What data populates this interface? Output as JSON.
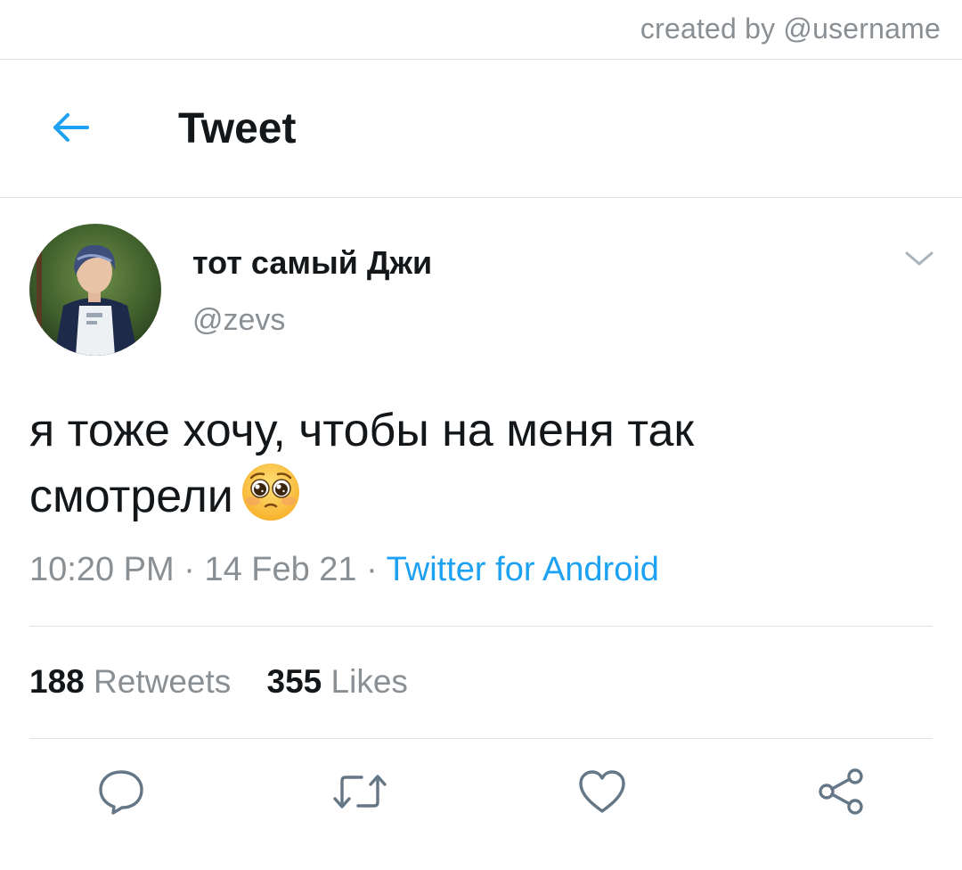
{
  "credit": "created by @username",
  "header": {
    "title": "Tweet",
    "back_icon": "arrow-left-icon"
  },
  "author": {
    "display_name": "тот самый Джи",
    "handle": "@zevs"
  },
  "tweet": {
    "line1": "я тоже хочу, чтобы на меня так",
    "line2": "смотрели",
    "emoji": "pleading-face-icon",
    "time": "10:20 PM",
    "sep1": " · ",
    "date": "14 Feb 21",
    "sep2": " · ",
    "source": "Twitter for Android"
  },
  "stats": {
    "retweets_count": "188",
    "retweets_label": "Retweets",
    "likes_count": "355",
    "likes_label": "Likes"
  },
  "actions": [
    "reply-icon",
    "retweet-icon",
    "like-icon",
    "share-icon"
  ],
  "colors": {
    "accent": "#1da1f2",
    "text": "#14171a",
    "muted": "#8a8f94",
    "divider": "#dfe3e6"
  }
}
